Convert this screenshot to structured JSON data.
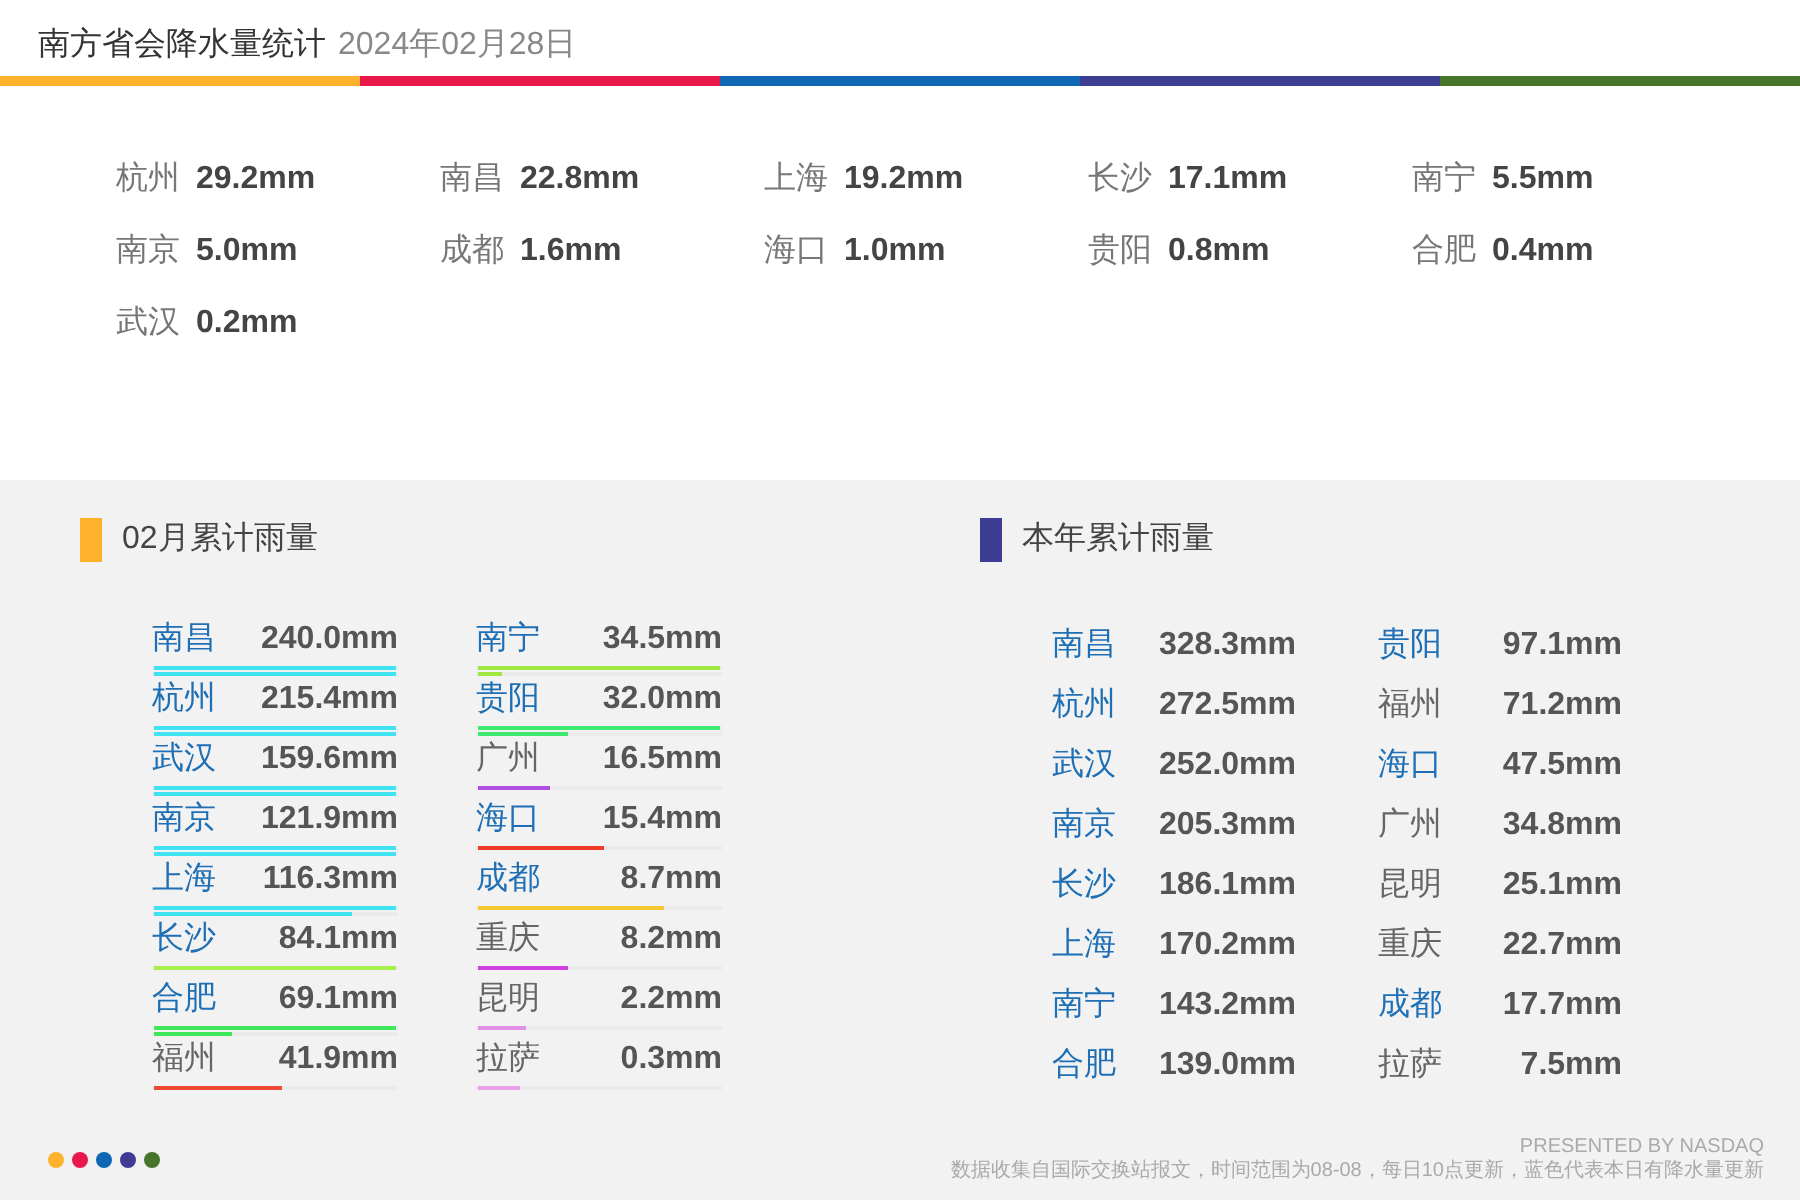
{
  "header": {
    "title": "南方省会降水量统计",
    "date": "2024年02月28日"
  },
  "color_bar": [
    {
      "color": "#fdb12c"
    },
    {
      "color": "#e8194a"
    },
    {
      "color": "#1068b4"
    },
    {
      "color": "#3d3d94"
    },
    {
      "color": "#48752c"
    }
  ],
  "daily": [
    {
      "city": "杭州",
      "value": "29.2mm"
    },
    {
      "city": "南昌",
      "value": "22.8mm"
    },
    {
      "city": "上海",
      "value": "19.2mm"
    },
    {
      "city": "长沙",
      "value": "17.1mm"
    },
    {
      "city": "南宁",
      "value": "5.5mm"
    },
    {
      "city": "南京",
      "value": "5.0mm"
    },
    {
      "city": "成都",
      "value": "1.6mm"
    },
    {
      "city": "海口",
      "value": "1.0mm"
    },
    {
      "city": "贵阳",
      "value": "0.8mm"
    },
    {
      "city": "合肥",
      "value": "0.4mm"
    },
    {
      "city": "武汉",
      "value": "0.2mm"
    }
  ],
  "monthly": {
    "title": "02月累计雨量",
    "color": "#fdb12c",
    "columns": [
      [
        {
          "city": "南昌",
          "value": "240.0mm",
          "rained_today": true,
          "color": "#3fe3f2",
          "bars": [
            {
              "level": 1
            },
            {
              "level": 1
            }
          ]
        },
        {
          "city": "杭州",
          "value": "215.4mm",
          "rained_today": true,
          "color": "#3fe3f2",
          "bars": [
            {
              "level": 1
            },
            {
              "level": 1
            }
          ]
        },
        {
          "city": "武汉",
          "value": "159.6mm",
          "rained_today": true,
          "color": "#3fe3f2",
          "bars": [
            {
              "level": 1
            },
            {
              "level": 1
            }
          ]
        },
        {
          "city": "南京",
          "value": "121.9mm",
          "rained_today": true,
          "color": "#3fe3f2",
          "bars": [
            {
              "level": 1
            },
            {
              "level": 1
            }
          ]
        },
        {
          "city": "上海",
          "value": "116.3mm",
          "rained_today": true,
          "color": "#3fe3f2",
          "bars": [
            {
              "level": 1
            },
            {
              "level": 0.82
            }
          ]
        },
        {
          "city": "长沙",
          "value": "84.1mm",
          "rained_today": true,
          "color": "#a8f04a",
          "bars": [
            {
              "level": 1
            }
          ]
        },
        {
          "city": "合肥",
          "value": "69.1mm",
          "rained_today": true,
          "color": "#3ee85a",
          "bars": [
            {
              "level": 1
            },
            {
              "level": 0.32
            }
          ]
        },
        {
          "city": "福州",
          "value": "41.9mm",
          "rained_today": false,
          "color": "#f04a30",
          "bars": [
            {
              "level": 0.53
            }
          ]
        }
      ],
      [
        {
          "city": "南宁",
          "value": "34.5mm",
          "rained_today": true,
          "color": "#a0e840",
          "bars": [
            {
              "level": 1
            },
            {
              "level": 0.1
            }
          ]
        },
        {
          "city": "贵阳",
          "value": "32.0mm",
          "rained_today": true,
          "color": "#40e870",
          "bars": [
            {
              "level": 1
            },
            {
              "level": 0.37
            }
          ]
        },
        {
          "city": "广州",
          "value": "16.5mm",
          "rained_today": false,
          "color": "#b050e0",
          "bars": [
            {
              "level": 0.3
            }
          ]
        },
        {
          "city": "海口",
          "value": "15.4mm",
          "rained_today": true,
          "color": "#f03a2a",
          "bars": [
            {
              "level": 0.52
            }
          ]
        },
        {
          "city": "成都",
          "value": "8.7mm",
          "rained_today": true,
          "color": "#f5c830",
          "bars": [
            {
              "level": 0.77
            }
          ]
        },
        {
          "city": "重庆",
          "value": "8.2mm",
          "rained_today": false,
          "color": "#d040e0",
          "bars": [
            {
              "level": 0.37
            }
          ]
        },
        {
          "city": "昆明",
          "value": "2.2mm",
          "rained_today": false,
          "color": "#e090e8",
          "bars": [
            {
              "level": 0.2
            }
          ]
        },
        {
          "city": "拉萨",
          "value": "0.3mm",
          "rained_today": false,
          "color": "#e8a0e8",
          "bars": [
            {
              "level": 0.17
            }
          ]
        }
      ]
    ]
  },
  "yearly": {
    "title": "本年累计雨量",
    "color": "#3d3d94",
    "columns": [
      [
        {
          "city": "南昌",
          "value": "328.3mm",
          "rained_today": true
        },
        {
          "city": "杭州",
          "value": "272.5mm",
          "rained_today": true
        },
        {
          "city": "武汉",
          "value": "252.0mm",
          "rained_today": true
        },
        {
          "city": "南京",
          "value": "205.3mm",
          "rained_today": true
        },
        {
          "city": "长沙",
          "value": "186.1mm",
          "rained_today": true
        },
        {
          "city": "上海",
          "value": "170.2mm",
          "rained_today": true
        },
        {
          "city": "南宁",
          "value": "143.2mm",
          "rained_today": true
        },
        {
          "city": "合肥",
          "value": "139.0mm",
          "rained_today": true
        }
      ],
      [
        {
          "city": "贵阳",
          "value": "97.1mm",
          "rained_today": true
        },
        {
          "city": "福州",
          "value": "71.2mm",
          "rained_today": false
        },
        {
          "city": "海口",
          "value": "47.5mm",
          "rained_today": true
        },
        {
          "city": "广州",
          "value": "34.8mm",
          "rained_today": false
        },
        {
          "city": "昆明",
          "value": "25.1mm",
          "rained_today": false
        },
        {
          "city": "重庆",
          "value": "22.7mm",
          "rained_today": false
        },
        {
          "city": "成都",
          "value": "17.7mm",
          "rained_today": true
        },
        {
          "city": "拉萨",
          "value": "7.5mm",
          "rained_today": false
        }
      ]
    ]
  },
  "footer": {
    "dots": [
      {
        "color": "#fdb12c"
      },
      {
        "color": "#e8194a"
      },
      {
        "color": "#1068b4"
      },
      {
        "color": "#3d3d94"
      },
      {
        "color": "#48752c"
      }
    ],
    "credit": "PRESENTED BY NASDAQ",
    "note": "数据收集自国际交换站报文，时间范围为08-08，每日10点更新，蓝色代表本日有降水量更新"
  }
}
